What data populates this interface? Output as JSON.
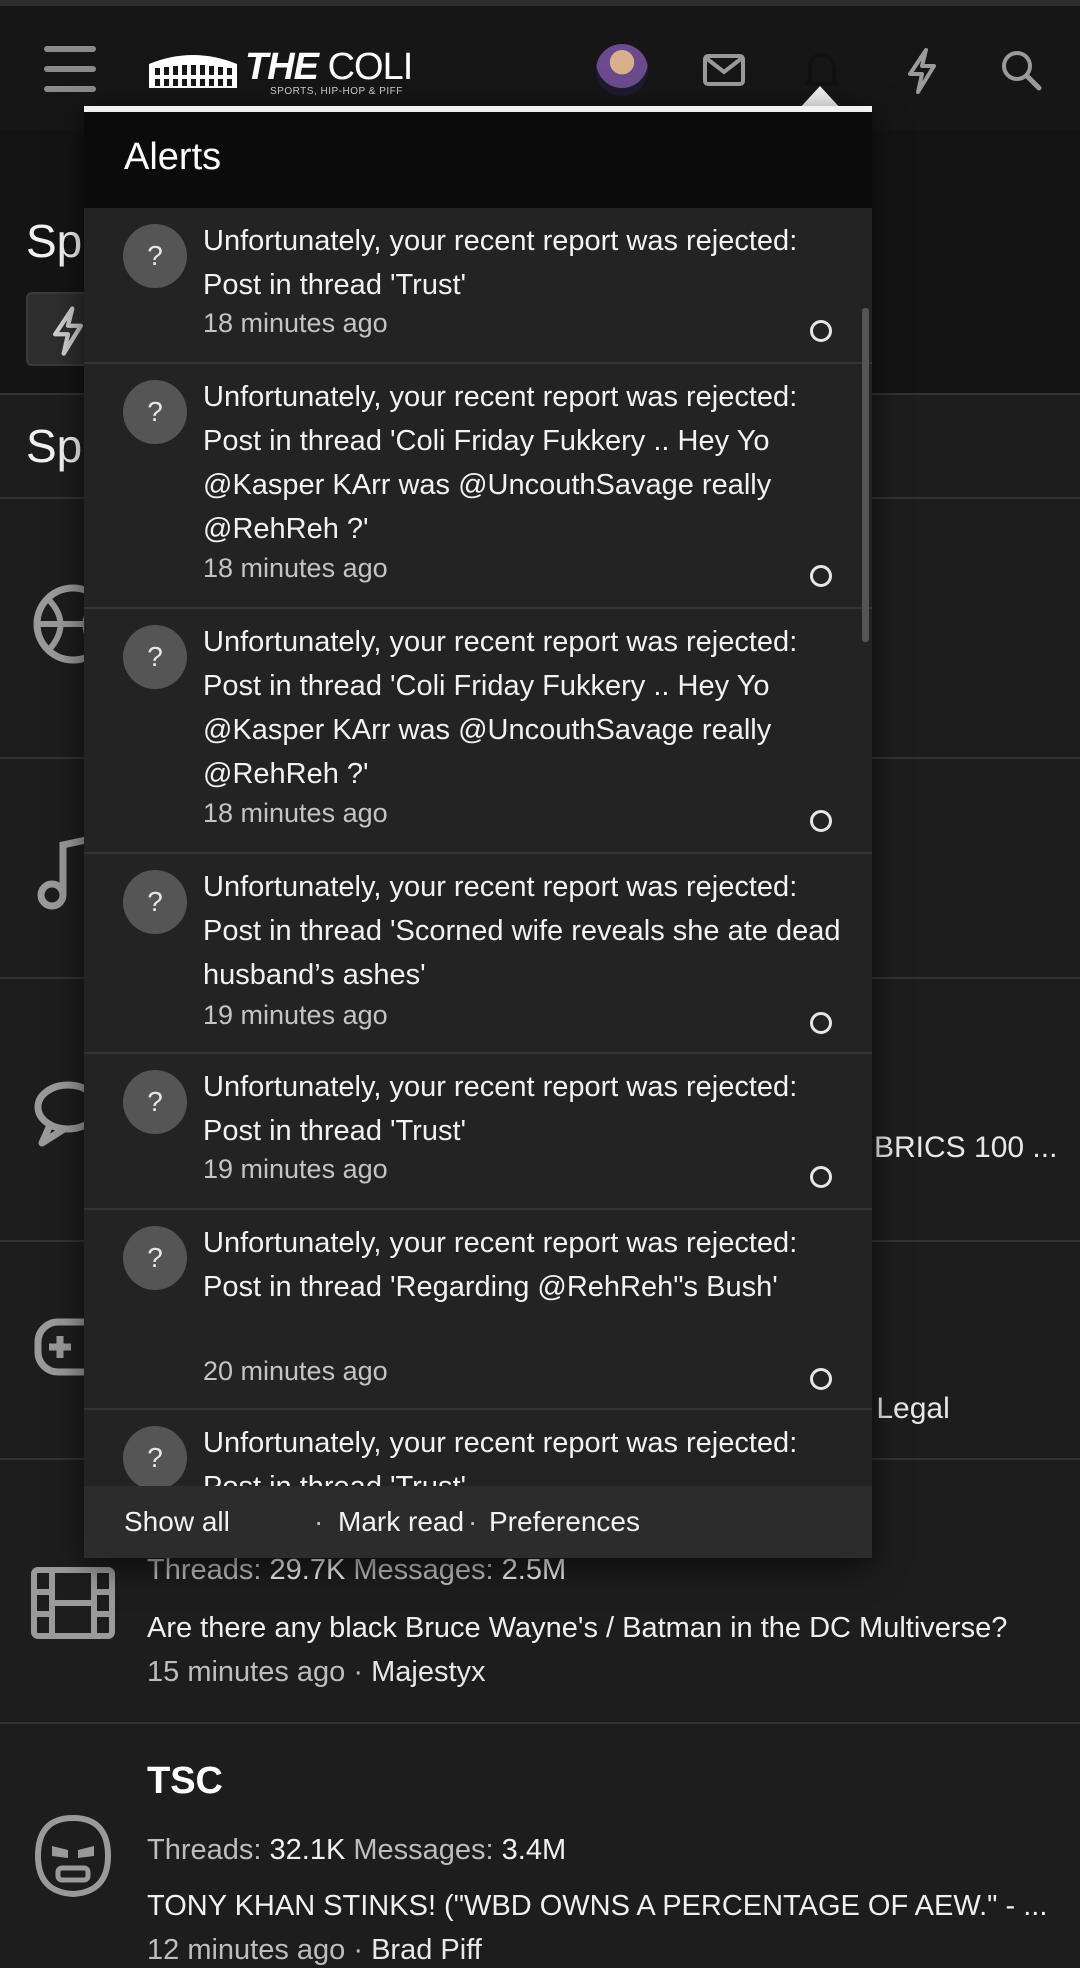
{
  "header": {
    "logo_word": "COLI",
    "logo_the": "THE",
    "logo_tagline": "SPORTS, HIP-HOP & PIFF"
  },
  "background": {
    "heading_fragment_1": "Sp",
    "heading_fragment_2": "Sp",
    "row_fragments": {
      "brics": "BRICS 100 ...",
      "legal": "· Legal"
    }
  },
  "forums": [
    {
      "stats_threads_label": "Threads:",
      "threads": "29.7K",
      "stats_messages_label": "Messages:",
      "messages": "2.5M",
      "latest": "Are there any black Bruce Wayne's / Batman in the DC Multiverse?",
      "time": "15 minutes ago",
      "author": "Majestyx"
    },
    {
      "title": "TSC",
      "stats_threads_label": "Threads:",
      "threads": "32.1K",
      "stats_messages_label": "Messages:",
      "messages": "3.4M",
      "latest": "TONY KHAN STINKS! (\"WBD OWNS A PERCENTAGE OF AEW.\" - ...",
      "time": "12 minutes ago",
      "author": "Brad Piff"
    }
  ],
  "alerts": {
    "title": "Alerts",
    "items": [
      {
        "icon": "?",
        "text": "Unfortunately, your recent report was rejected: Post in thread 'Trust'",
        "time": "18 minutes ago"
      },
      {
        "icon": "?",
        "text": "Unfortunately, your recent report was rejected: Post in thread 'Coli Friday Fukkery .. Hey Yo @Kasper KArr was @UncouthSavage really @RehReh ?'",
        "time": "18 minutes ago"
      },
      {
        "icon": "?",
        "text": "Unfortunately, your recent report was rejected: Post in thread 'Coli Friday Fukkery .. Hey Yo @Kasper KArr was @UncouthSavage really @RehReh ?'",
        "time": "18 minutes ago"
      },
      {
        "icon": "?",
        "text": "Unfortunately, your recent report was rejected: Post in thread 'Scorned wife reveals she ate dead husband’s ashes'",
        "time": "19 minutes ago"
      },
      {
        "icon": "?",
        "text": "Unfortunately, your recent report was rejected: Post in thread 'Trust'",
        "time": "19 minutes ago"
      },
      {
        "icon": "?",
        "text": "Unfortunately, your recent report was rejected: Post in thread 'Regarding @RehReh\"s Bush'",
        "time": "20 minutes ago"
      },
      {
        "icon": "?",
        "text": "Unfortunately, your recent report was rejected: Post in thread 'Trust'",
        "time": ""
      }
    ],
    "footer": {
      "show_all": "Show all",
      "sep1": "·",
      "mark_read": "Mark read",
      "sep2": "·",
      "preferences": "Preferences"
    }
  }
}
